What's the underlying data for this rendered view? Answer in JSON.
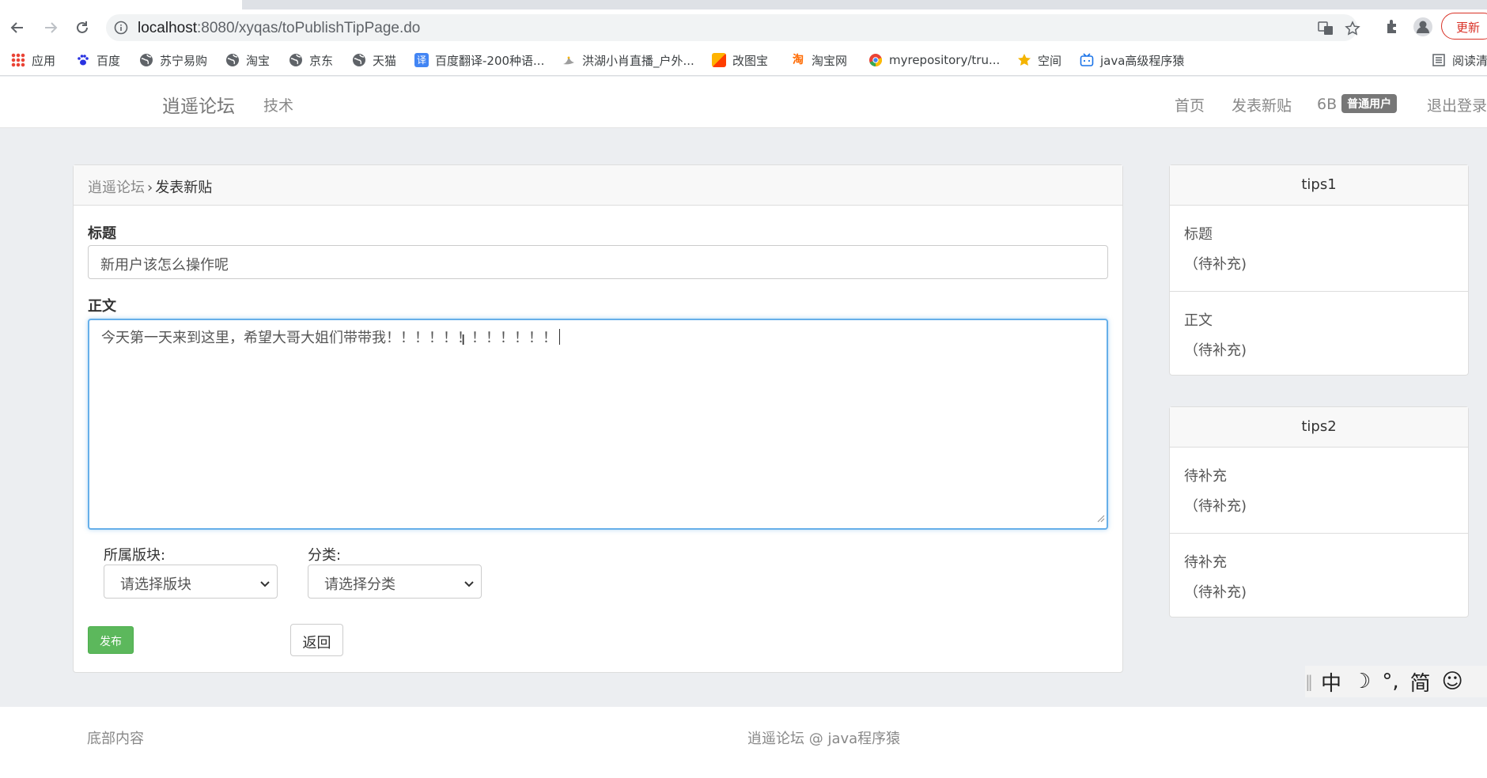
{
  "browser": {
    "url_host": "localhost",
    "url_path": ":8080/xyqas/toPublishTipPage.do",
    "update_label": "更新",
    "bookmarks": [
      {
        "label": "应用",
        "color": "#1a73e8",
        "icon": "apps-grid-icon"
      },
      {
        "label": "百度",
        "color": "#2932e1",
        "icon": "paw-icon"
      },
      {
        "label": "苏宁易购",
        "color": "#5f6368",
        "icon": "globe-icon"
      },
      {
        "label": "淘宝",
        "color": "#5f6368",
        "icon": "globe-icon"
      },
      {
        "label": "京东",
        "color": "#5f6368",
        "icon": "globe-icon"
      },
      {
        "label": "天猫",
        "color": "#5f6368",
        "icon": "globe-icon"
      },
      {
        "label": "百度翻译-200种语...",
        "color": "#4285f4",
        "icon": "translate-icon"
      },
      {
        "label": "洪湖小肖直播_户外...",
        "color": "#a0a0a0",
        "icon": "bird-icon"
      },
      {
        "label": "改图宝",
        "color": "#ff5722",
        "icon": "image-icon"
      },
      {
        "label": "淘宝网",
        "color": "#ff6a00",
        "icon": "taobao-icon"
      },
      {
        "label": "myrepository/tru...",
        "color": "#34a853",
        "icon": "chrome-icon"
      },
      {
        "label": "空间",
        "color": "#f4b400",
        "icon": "qzone-icon"
      },
      {
        "label": "java高级程序猿",
        "color": "#1a73e8",
        "icon": "bilibili-icon"
      }
    ],
    "reading_list": "阅读清"
  },
  "nav": {
    "brand": "逍遥论坛",
    "category": "技术",
    "home": "首页",
    "publish": "发表新贴",
    "username": "6B",
    "role_badge": "普通用户",
    "logout": "退出登录"
  },
  "form": {
    "breadcrumb_home": "逍遥论坛",
    "breadcrumb_sep": "›",
    "breadcrumb_current": "发表新贴",
    "title_label": "标题",
    "title_value": "新用户该怎么操作呢",
    "body_label": "正文",
    "body_value": "今天第一天来到这里，希望大哥大姐们带带我！！！！！！！！！！！！",
    "board_label": "所属版块:",
    "board_selected": "请选择版块",
    "category_label": "分类:",
    "category_selected": "请选择分类",
    "publish_button": "发布",
    "back_button": "返回"
  },
  "tips1": {
    "title": "tips1",
    "items": [
      {
        "t": "标题",
        "d": "（待补充)"
      },
      {
        "t": "正文",
        "d": "（待补充)"
      }
    ]
  },
  "tips2": {
    "title": "tips2",
    "items": [
      {
        "t": "待补充",
        "d": "（待补充)"
      },
      {
        "t": "待补充",
        "d": "（待补充)"
      }
    ]
  },
  "ime": {
    "mode": "中",
    "moon": "☽",
    "punct": "°,",
    "simplified": "简",
    "smile": "☺"
  },
  "footer": {
    "left": "底部内容",
    "center": "逍遥论坛 @ java程序猿"
  }
}
